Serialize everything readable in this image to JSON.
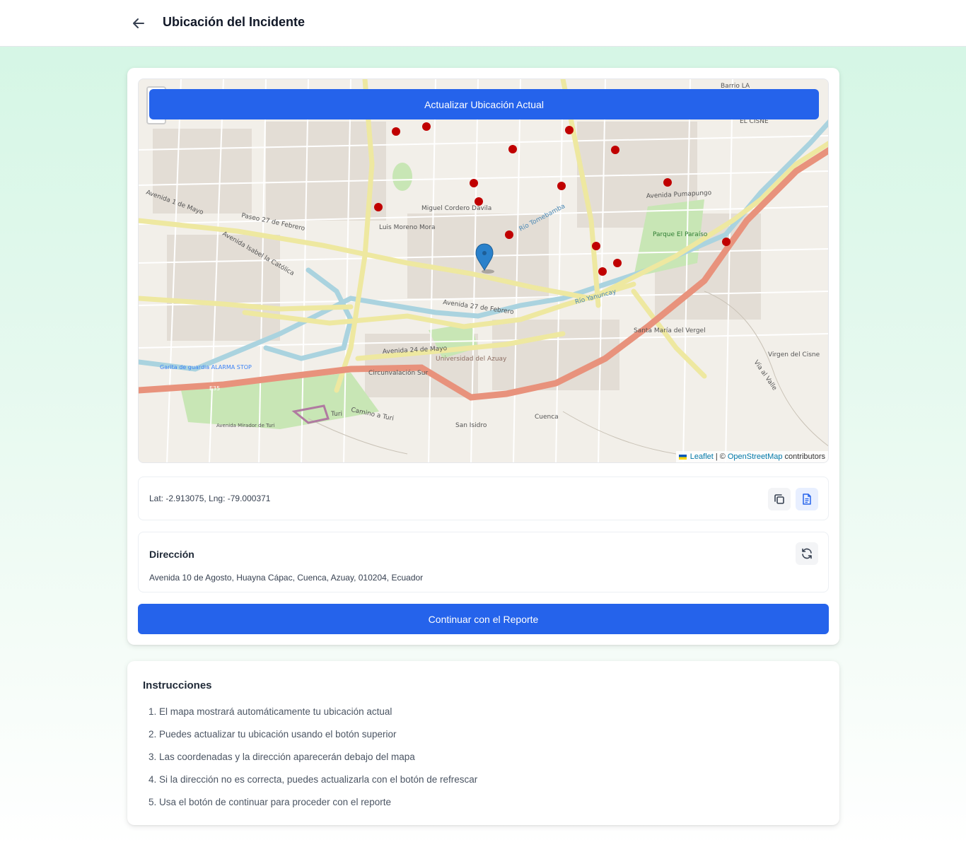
{
  "header": {
    "title": "Ubicación del Incidente",
    "back_icon": "arrow-left-icon"
  },
  "map": {
    "update_button_label": "Actualizar Ubicación Actual",
    "attribution": {
      "leaflet": "Leaflet",
      "separator": "| ©",
      "osm": "OpenStreetMap",
      "contributors": "contributors"
    },
    "labels": [
      "Avenida 1 de Mayo",
      "Avenida 27 de Febrero",
      "Avenida 24 de Mayo",
      "Circunvalación Sur",
      "Avenida Pumapungo",
      "Avenida Isabel la Católica",
      "Río Yanuncay",
      "Río Tomebamba",
      "Parque El Paraíso",
      "Santa María del Vergel",
      "Universidad del Azuay",
      "Camino a Turi",
      "Turi",
      "San Isidro",
      "Cuenca",
      "Virgen del Cisne",
      "EL CISNE",
      "Barrio LA",
      "E35",
      "Garita de guardia ALARMA STOP",
      "Luis Moreno Mora",
      "Miguel Cordero Dávila",
      "Vía al Valle",
      "Avenida Mirador de Turi",
      "Paseo 27 de Febrero"
    ],
    "colors": {
      "marker": "#2a81cb",
      "hospital": "#c00000",
      "highway": "#e8927c",
      "primary_road": "#f7f4a8",
      "water": "#aad3df",
      "park": "#c8e6b5"
    }
  },
  "coordinates": {
    "text": "Lat: -2.913075, Lng: -79.000371",
    "copy_icon": "copy-icon",
    "doc_icon": "document-icon"
  },
  "address": {
    "label": "Dirección",
    "value": "Avenida 10 de Agosto, Huayna Cápac, Cuenca, Azuay, 010204, Ecuador",
    "refresh_icon": "refresh-icon"
  },
  "continue_button_label": "Continuar con el Reporte",
  "instructions": {
    "title": "Instrucciones",
    "items": [
      "1. El mapa mostrará automáticamente tu ubicación actual",
      "2. Puedes actualizar tu ubicación usando el botón superior",
      "3. Las coordenadas y la dirección aparecerán debajo del mapa",
      "4. Si la dirección no es correcta, puedes actualizarla con el botón de refrescar",
      "5. Usa el botón de continuar para proceder con el reporte"
    ]
  }
}
